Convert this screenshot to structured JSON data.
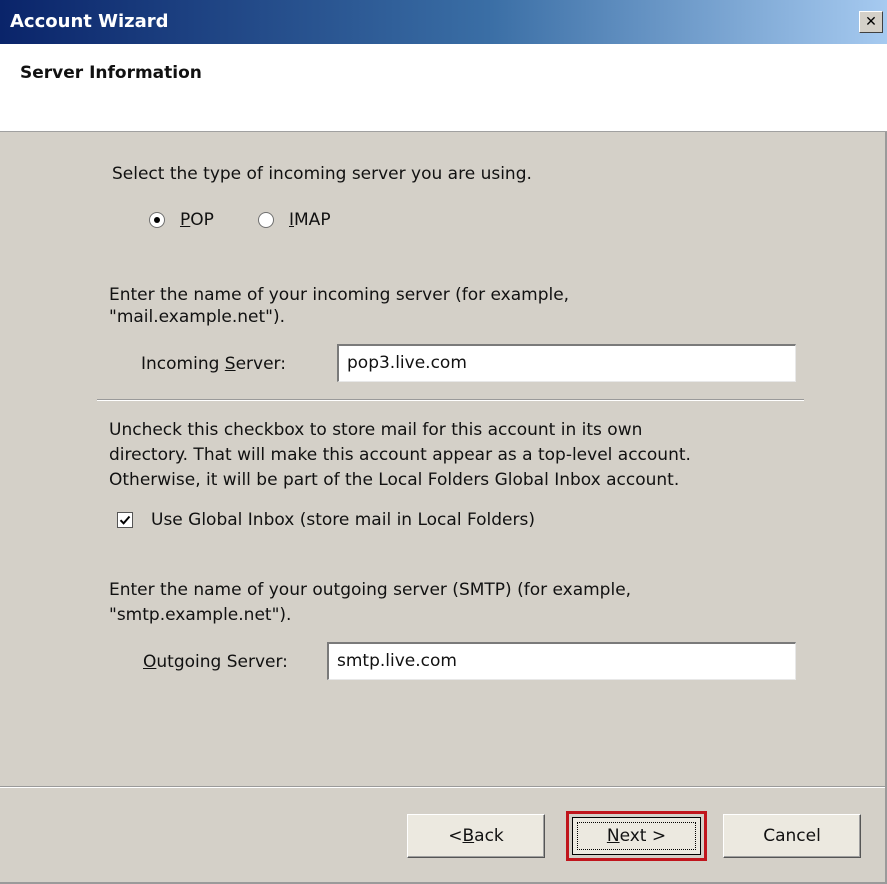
{
  "window": {
    "title": "Account Wizard",
    "close_glyph": "✕"
  },
  "header": {
    "title": "Server Information"
  },
  "server_type": {
    "instruction": "Select the type of incoming server you are using.",
    "options": [
      {
        "key": "P",
        "rest": "OP",
        "selected": true
      },
      {
        "key": "I",
        "rest": "MAP",
        "selected": false
      }
    ]
  },
  "incoming": {
    "instruction_line1": "Enter the name of your incoming server (for example,",
    "instruction_line2": "\"mail.example.net\").",
    "label_pre": "Incoming ",
    "label_key": "S",
    "label_post": "erver:",
    "value": "pop3.live.com"
  },
  "global_inbox": {
    "text_line1": "Uncheck this checkbox to store mail for this account in its own",
    "text_line2": "directory. That will make this account appear as a top-level account.",
    "text_line3": "Otherwise, it will be part of the Local Folders Global Inbox account.",
    "checkbox_label": "Use Global Inbox (store mail in Local Folders)",
    "checked": true
  },
  "outgoing": {
    "instruction_line1": "Enter the name of your outgoing server (SMTP) (for example,",
    "instruction_line2": "\"smtp.example.net\").",
    "label_key": "O",
    "label_post": "utgoing Server:",
    "value": "smtp.live.com"
  },
  "buttons": {
    "back_pre": "< ",
    "back_key": "B",
    "back_post": "ack",
    "next_key": "N",
    "next_post": "ext >",
    "cancel": "Cancel"
  },
  "colors": {
    "highlight_border": "#c0151c"
  }
}
